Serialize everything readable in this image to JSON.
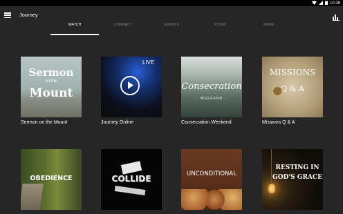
{
  "status_bar": {
    "time": "10:26"
  },
  "app_bar": {
    "title": "Journey"
  },
  "tabs": [
    {
      "label": "WATCH",
      "active": true
    },
    {
      "label": "CONNECT",
      "active": false
    },
    {
      "label": "EVENTS",
      "active": false
    },
    {
      "label": "MUSIC",
      "active": false
    },
    {
      "label": "MORE",
      "active": false
    }
  ],
  "tiles": [
    {
      "caption": "Sermon on the Mount",
      "art_lines": [
        "Sermon",
        "on the",
        "Mount"
      ]
    },
    {
      "caption": "Journey Online",
      "badge": "LIVE"
    },
    {
      "caption": "Consecration Weekend",
      "art_lines": [
        "Consecration",
        "- WEEKEND -"
      ]
    },
    {
      "caption": "Missions Q & A",
      "art_lines": [
        "MISSIONS",
        "Q & A"
      ]
    },
    {
      "caption": "",
      "art_lines": [
        "OBEDIENCE"
      ]
    },
    {
      "caption": "",
      "art_lines": [
        "COLLIDE"
      ]
    },
    {
      "caption": "",
      "art_lines": [
        "UNCONDITIONAL"
      ]
    },
    {
      "caption": "",
      "art_lines": [
        "RESTING IN",
        "GOD'S GRACE"
      ]
    }
  ]
}
